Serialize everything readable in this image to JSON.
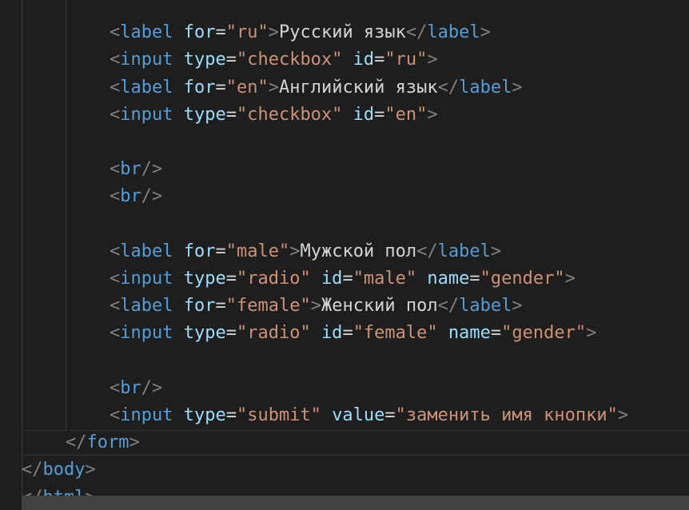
{
  "editor": {
    "lines": [
      [],
      [
        [
          "bracket",
          "<"
        ],
        [
          "tag",
          "label"
        ],
        [
          "text",
          " "
        ],
        [
          "attr",
          "for"
        ],
        [
          "punct",
          "="
        ],
        [
          "str",
          "\"ru\""
        ],
        [
          "bracket",
          ">"
        ],
        [
          "text",
          "Русский язык"
        ],
        [
          "bracket",
          "</"
        ],
        [
          "tag",
          "label"
        ],
        [
          "bracket",
          ">"
        ]
      ],
      [
        [
          "bracket",
          "<"
        ],
        [
          "tag",
          "input"
        ],
        [
          "text",
          " "
        ],
        [
          "attr",
          "type"
        ],
        [
          "punct",
          "="
        ],
        [
          "str",
          "\"checkbox\""
        ],
        [
          "text",
          " "
        ],
        [
          "attr",
          "id"
        ],
        [
          "punct",
          "="
        ],
        [
          "str",
          "\"ru\""
        ],
        [
          "bracket",
          ">"
        ]
      ],
      [
        [
          "bracket",
          "<"
        ],
        [
          "tag",
          "label"
        ],
        [
          "text",
          " "
        ],
        [
          "attr",
          "for"
        ],
        [
          "punct",
          "="
        ],
        [
          "str",
          "\"en\""
        ],
        [
          "bracket",
          ">"
        ],
        [
          "text",
          "Английский язык"
        ],
        [
          "bracket",
          "</"
        ],
        [
          "tag",
          "label"
        ],
        [
          "bracket",
          ">"
        ]
      ],
      [
        [
          "bracket",
          "<"
        ],
        [
          "tag",
          "input"
        ],
        [
          "text",
          " "
        ],
        [
          "attr",
          "type"
        ],
        [
          "punct",
          "="
        ],
        [
          "str",
          "\"checkbox\""
        ],
        [
          "text",
          " "
        ],
        [
          "attr",
          "id"
        ],
        [
          "punct",
          "="
        ],
        [
          "str",
          "\"en\""
        ],
        [
          "bracket",
          ">"
        ]
      ],
      [],
      [
        [
          "bracket",
          "<"
        ],
        [
          "tag",
          "br"
        ],
        [
          "bracket",
          "/>"
        ]
      ],
      [
        [
          "bracket",
          "<"
        ],
        [
          "tag",
          "br"
        ],
        [
          "bracket",
          "/>"
        ]
      ],
      [],
      [
        [
          "bracket",
          "<"
        ],
        [
          "tag",
          "label"
        ],
        [
          "text",
          " "
        ],
        [
          "attr",
          "for"
        ],
        [
          "punct",
          "="
        ],
        [
          "str",
          "\"male\""
        ],
        [
          "bracket",
          ">"
        ],
        [
          "text",
          "Мужской пол"
        ],
        [
          "bracket",
          "</"
        ],
        [
          "tag",
          "label"
        ],
        [
          "bracket",
          ">"
        ]
      ],
      [
        [
          "bracket",
          "<"
        ],
        [
          "tag",
          "input"
        ],
        [
          "text",
          " "
        ],
        [
          "attr",
          "type"
        ],
        [
          "punct",
          "="
        ],
        [
          "str",
          "\"radio\""
        ],
        [
          "text",
          " "
        ],
        [
          "attr",
          "id"
        ],
        [
          "punct",
          "="
        ],
        [
          "str",
          "\"male\""
        ],
        [
          "text",
          " "
        ],
        [
          "attr",
          "name"
        ],
        [
          "punct",
          "="
        ],
        [
          "str",
          "\"gender\""
        ],
        [
          "bracket",
          ">"
        ]
      ],
      [
        [
          "bracket",
          "<"
        ],
        [
          "tag",
          "label"
        ],
        [
          "text",
          " "
        ],
        [
          "attr",
          "for"
        ],
        [
          "punct",
          "="
        ],
        [
          "str",
          "\"female\""
        ],
        [
          "bracket",
          ">"
        ],
        [
          "text",
          "Женский пол"
        ],
        [
          "bracket",
          "</"
        ],
        [
          "tag",
          "label"
        ],
        [
          "bracket",
          ">"
        ]
      ],
      [
        [
          "bracket",
          "<"
        ],
        [
          "tag",
          "input"
        ],
        [
          "text",
          " "
        ],
        [
          "attr",
          "type"
        ],
        [
          "punct",
          "="
        ],
        [
          "str",
          "\"radio\""
        ],
        [
          "text",
          " "
        ],
        [
          "attr",
          "id"
        ],
        [
          "punct",
          "="
        ],
        [
          "str",
          "\"female\""
        ],
        [
          "text",
          " "
        ],
        [
          "attr",
          "name"
        ],
        [
          "punct",
          "="
        ],
        [
          "str",
          "\"gender\""
        ],
        [
          "bracket",
          ">"
        ]
      ],
      [],
      [
        [
          "bracket",
          "<"
        ],
        [
          "tag",
          "br"
        ],
        [
          "bracket",
          "/>"
        ]
      ],
      [
        [
          "bracket",
          "<"
        ],
        [
          "tag",
          "input"
        ],
        [
          "text",
          " "
        ],
        [
          "attr",
          "type"
        ],
        [
          "punct",
          "="
        ],
        [
          "str",
          "\"submit\""
        ],
        [
          "text",
          " "
        ],
        [
          "attr",
          "value"
        ],
        [
          "punct",
          "="
        ],
        [
          "str",
          "\"заменить имя кнопки\""
        ],
        [
          "bracket",
          ">"
        ]
      ],
      [
        [
          "bracket",
          "</"
        ],
        [
          "tag",
          "form"
        ],
        [
          "bracket",
          ">"
        ]
      ],
      [
        [
          "bracket",
          "</"
        ],
        [
          "tag",
          "body"
        ],
        [
          "bracket",
          ">"
        ]
      ],
      [
        [
          "bracket",
          "</"
        ],
        [
          "tag",
          "html"
        ],
        [
          "bracket",
          ">"
        ]
      ]
    ],
    "colors": {
      "background": "#1e1e1e",
      "tag": "#569cd6",
      "attribute": "#9cdcfe",
      "string": "#ce9178",
      "bracket": "#808080",
      "text": "#d4d4d4"
    }
  }
}
